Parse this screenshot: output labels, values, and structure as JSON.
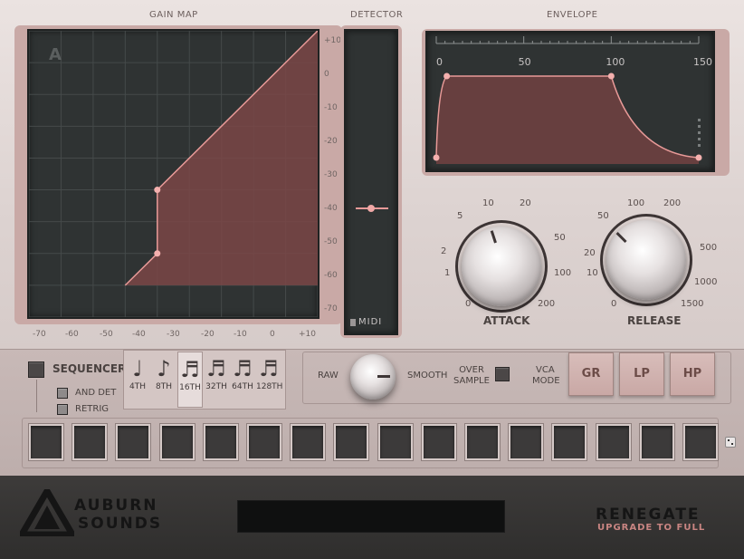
{
  "sections": {
    "gain_map": "GAIN MAP",
    "detector": "DETECTOR",
    "envelope": "ENVELOPE"
  },
  "gain_map": {
    "corner_glyph": "A",
    "x_ticks": [
      "-70",
      "-60",
      "-50",
      "-40",
      "-30",
      "-20",
      "-10",
      "0",
      "+10"
    ],
    "y_ticks": [
      "+10",
      "0",
      "-10",
      "-20",
      "-30",
      "-40",
      "-50",
      "-60",
      "-70"
    ],
    "curve_points_db": [
      [
        -50,
        -70
      ],
      [
        -40,
        -60
      ],
      [
        -40,
        -40
      ],
      [
        10,
        10
      ]
    ]
  },
  "detector": {
    "midi_label": "MIDI",
    "level_db": -40
  },
  "envelope": {
    "ticks": [
      "0",
      "50",
      "100",
      "150"
    ],
    "points": [
      [
        0,
        0
      ],
      [
        6,
        1
      ],
      [
        100,
        1
      ],
      [
        150,
        0
      ]
    ]
  },
  "attack": {
    "title": "ATTACK",
    "labels": [
      "0",
      "1",
      "2",
      "5",
      "10",
      "20",
      "50",
      "100",
      "200"
    ]
  },
  "release": {
    "title": "RELEASE",
    "labels": [
      "0",
      "10",
      "20",
      "50",
      "100",
      "200",
      "500",
      "1000",
      "1500"
    ]
  },
  "sequencer": {
    "label": "SEQUENCER",
    "and_det": "AND DET",
    "retrig": "RETRIG",
    "notes": [
      {
        "glyph": "♩",
        "label": "4TH"
      },
      {
        "glyph": "♪",
        "label": "8TH"
      },
      {
        "glyph": "♬",
        "label": "16TH"
      },
      {
        "glyph": "♬",
        "label": "32TH"
      },
      {
        "glyph": "♬",
        "label": "64TH"
      },
      {
        "glyph": "♬",
        "label": "128TH"
      }
    ],
    "steps": 16
  },
  "smoothing": {
    "raw": "RAW",
    "smooth": "SMOOTH"
  },
  "oversample": {
    "line1": "OVER",
    "line2": "SAMPLE"
  },
  "vca_mode": {
    "line1": "VCA",
    "line2": "MODE",
    "buttons": [
      "GR",
      "LP",
      "HP"
    ]
  },
  "footer": {
    "brand_line1": "AUBURN",
    "brand_line2": "SOUNDS",
    "product": "RENEGATE",
    "upgrade": "UPGRADE TO FULL"
  },
  "colors": {
    "accent": "#e89a98",
    "screen": "#2f3333",
    "fill": "#7a4646"
  }
}
